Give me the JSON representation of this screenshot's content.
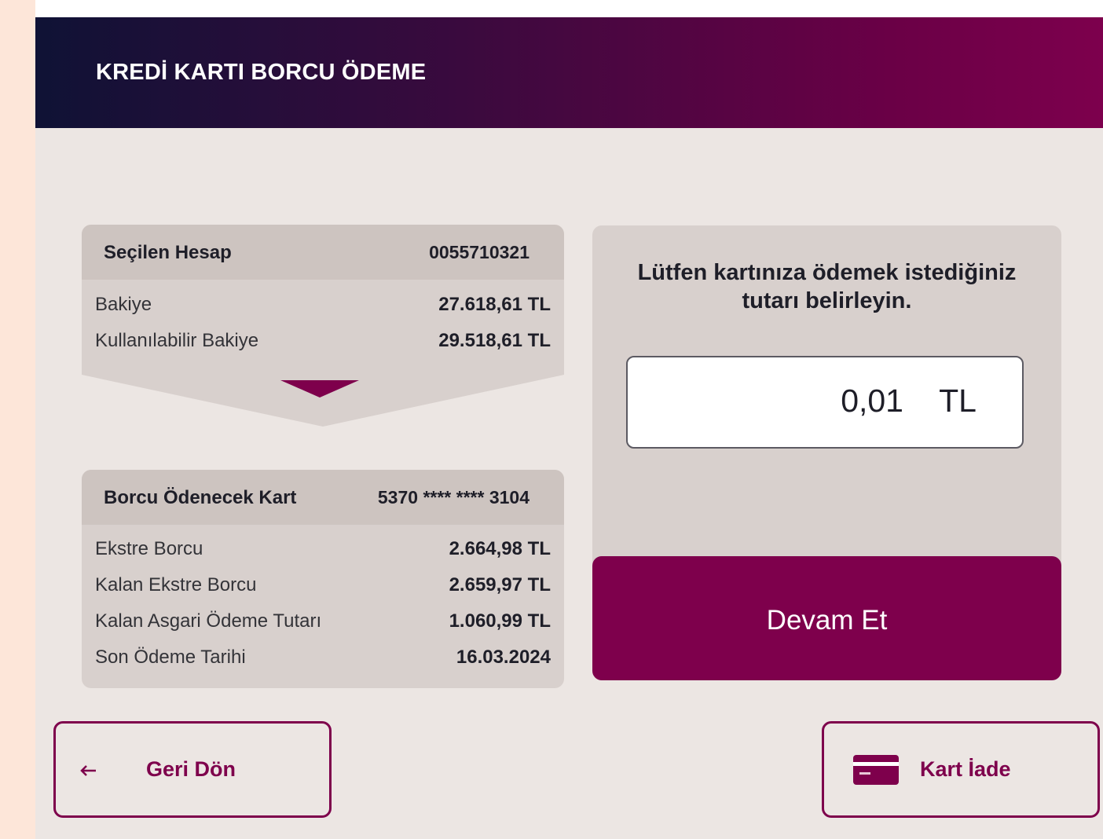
{
  "header": {
    "title": "KREDİ KARTI BORCU ÖDEME"
  },
  "account": {
    "label": "Seçilen Hesap",
    "number": "0055710321",
    "rows": [
      {
        "label": "Bakiye",
        "value": "27.618,61 TL"
      },
      {
        "label": "Kullanılabilir Bakiye",
        "value": "29.518,61 TL"
      }
    ]
  },
  "card": {
    "label": "Borcu Ödenecek Kart",
    "number": "5370 **** **** 3104",
    "rows": [
      {
        "label": "Ekstre Borcu",
        "value": "2.664,98 TL"
      },
      {
        "label": "Kalan Ekstre Borcu",
        "value": "2.659,97 TL"
      },
      {
        "label": "Kalan Asgari Ödeme Tutarı",
        "value": "1.060,99 TL"
      },
      {
        "label": "Son Ödeme Tarihi",
        "value": "16.03.2024"
      }
    ]
  },
  "payment": {
    "instruction": "Lütfen kartınıza ödemek istediğiniz tutarı belirleyin.",
    "amount": "0,01",
    "currency": "TL",
    "continue_label": "Devam Et"
  },
  "footer": {
    "back_label": "Geri Dön",
    "back_icon": "arrow-left-icon",
    "eject_label": "Kart İade",
    "eject_icon": "credit-card-icon"
  },
  "colors": {
    "brand": "#7e004c",
    "header_start": "#0f1235",
    "header_end": "#7d004d",
    "panel": "#d8d0cd",
    "background": "#ece6e3"
  }
}
